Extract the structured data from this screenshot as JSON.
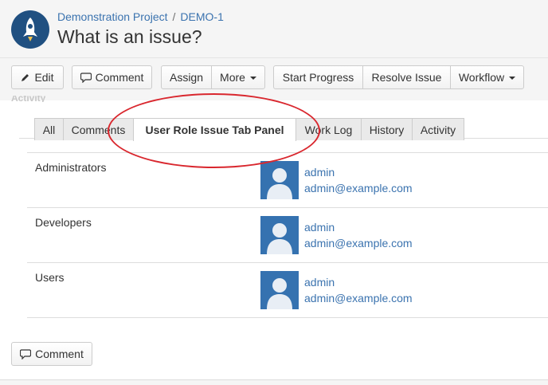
{
  "breadcrumb": {
    "project": "Demonstration Project",
    "separator": "/",
    "issue_key": "DEMO-1"
  },
  "issue": {
    "title": "What is an issue?"
  },
  "toolbar": {
    "edit": "Edit",
    "comment": "Comment",
    "assign": "Assign",
    "more": "More",
    "start_progress": "Start Progress",
    "resolve_issue": "Resolve Issue",
    "workflow": "Workflow"
  },
  "activity_label": "Activity",
  "tabs": [
    "All",
    "Comments",
    "User Role Issue Tab Panel",
    "Work Log",
    "History",
    "Activity"
  ],
  "roles": [
    {
      "role": "Administrators",
      "user": "admin",
      "email": "admin@example.com"
    },
    {
      "role": "Developers",
      "user": "admin",
      "email": "admin@example.com"
    },
    {
      "role": "Users",
      "user": "admin",
      "email": "admin@example.com"
    }
  ],
  "footer": {
    "comment": "Comment"
  },
  "colors": {
    "link": "#3b73af",
    "annotation": "#d9272e",
    "avatar": "#3572b0",
    "project_avatar": "#205081"
  }
}
